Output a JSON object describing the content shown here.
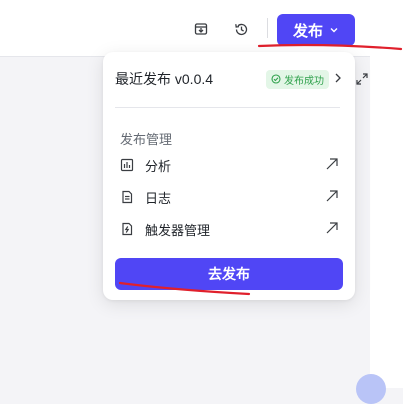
{
  "header": {
    "publish_button_label": "发布",
    "icons": [
      "archive-download-icon",
      "history-icon",
      "chevron-down-icon"
    ]
  },
  "dropdown": {
    "latest_release_label": "最近发布 v0.0.4",
    "status_badge": "发布成功",
    "section_title": "发布管理",
    "items": [
      {
        "label": "分析",
        "icon": "chart-icon"
      },
      {
        "label": "日志",
        "icon": "log-document-icon"
      },
      {
        "label": "触发器管理",
        "icon": "trigger-icon"
      }
    ],
    "go_publish_label": "去发布"
  },
  "colors": {
    "accent": "#5046f5",
    "success_bg": "#e3f6e7",
    "success_text": "#2fa14c",
    "annotation_red": "#e0202c"
  }
}
